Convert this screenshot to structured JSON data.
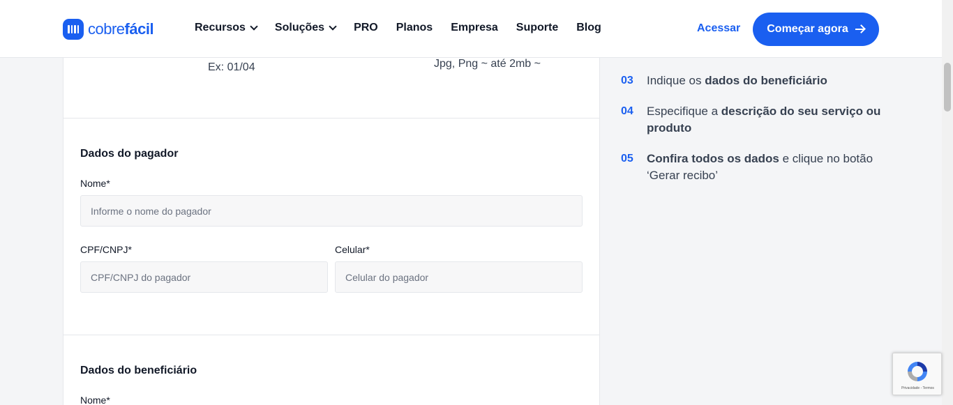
{
  "header": {
    "logo": {
      "light": "cobre",
      "bold": "fácil"
    },
    "nav": [
      {
        "label": "Recursos",
        "has_dropdown": true
      },
      {
        "label": "Soluções",
        "has_dropdown": true
      },
      {
        "label": "PRO",
        "has_dropdown": false
      },
      {
        "label": "Planos",
        "has_dropdown": false
      },
      {
        "label": "Empresa",
        "has_dropdown": false
      },
      {
        "label": "Suporte",
        "has_dropdown": false
      },
      {
        "label": "Blog",
        "has_dropdown": false
      }
    ],
    "login_label": "Acessar",
    "cta_label": "Começar agora"
  },
  "form": {
    "date_hint": "Ex: 01/04",
    "file_hint": "Jpg, Png ~ até 2mb ~",
    "payer": {
      "title": "Dados do pagador",
      "name_label": "Nome*",
      "name_placeholder": "Informe o nome do pagador",
      "doc_label": "CPF/CNPJ*",
      "doc_placeholder": "CPF/CNPJ do pagador",
      "phone_label": "Celular*",
      "phone_placeholder": "Celular do pagador"
    },
    "beneficiary": {
      "title": "Dados do beneficiário",
      "name_label": "Nome*"
    }
  },
  "steps": [
    {
      "num": "03",
      "parts": [
        [
          "Indique os ",
          false
        ],
        [
          "dados do beneficiário",
          true
        ]
      ]
    },
    {
      "num": "04",
      "parts": [
        [
          "Especifique a ",
          false
        ],
        [
          "descrição do seu serviço ou produto",
          true
        ]
      ]
    },
    {
      "num": "05",
      "parts": [
        [
          "Confira todos os dados",
          true
        ],
        [
          " e clique no botão ‘Gerar recibo’",
          false
        ]
      ]
    }
  ],
  "recaptcha": {
    "text": "Privacidade - Termos"
  },
  "colors": {
    "brand": "#1a5ff0",
    "text": "#111827",
    "muted": "#374151"
  }
}
